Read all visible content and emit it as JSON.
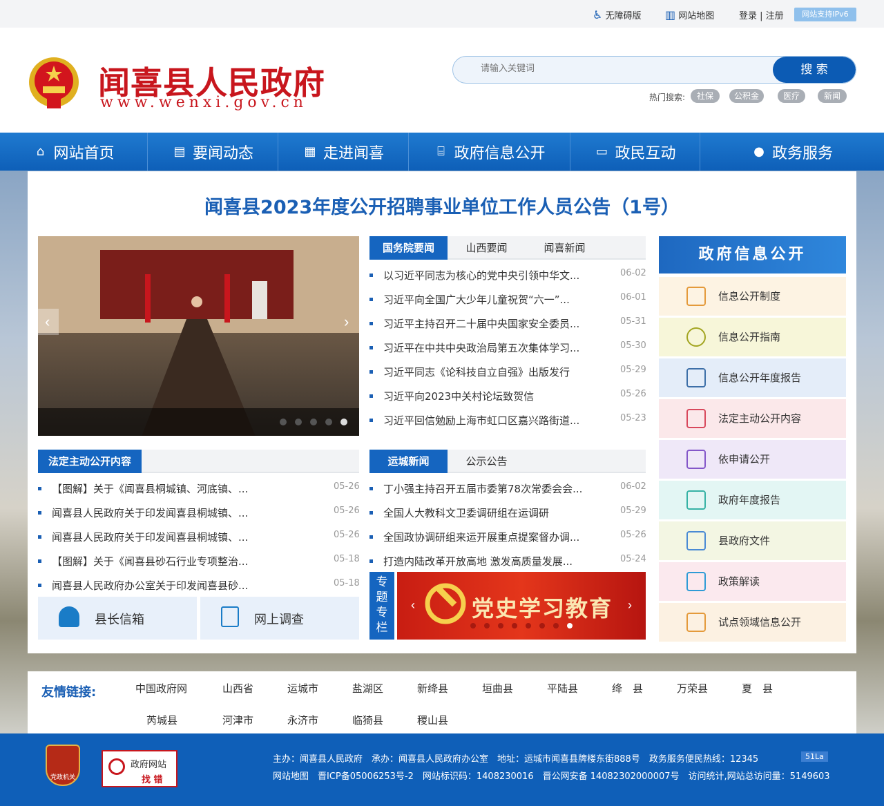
{
  "topbar": {
    "accessibility": "无障碍版",
    "sitemap": "网站地图",
    "login": "登录 | 注册",
    "ipv6": "网站支持IPv6"
  },
  "header": {
    "title": "闻喜县人民政府",
    "url": "www.wenxi.gov.cn",
    "search_placeholder": "请输入关键词",
    "search_button": "搜 索",
    "hot_label": "热门搜索:",
    "hot_tags": [
      "社保",
      "公积金",
      "医疗",
      "新闻"
    ]
  },
  "nav": [
    {
      "label": "网站首页",
      "icon": "home-icon"
    },
    {
      "label": "要闻动态",
      "icon": "news-icon"
    },
    {
      "label": "走进闻喜",
      "icon": "building-icon"
    },
    {
      "label": "政府信息公开",
      "icon": "government-icon"
    },
    {
      "label": "政民互动",
      "icon": "chat-icon"
    },
    {
      "label": "政务服务",
      "icon": "user-icon"
    }
  ],
  "headline": "闻喜县2023年度公开招聘事业单位工作人员公告（1号）",
  "news_tabs": [
    "国务院要闻",
    "山西要闻",
    "闻喜新闻"
  ],
  "news": [
    {
      "title": "以习近平同志为核心的党中央引领中华文...",
      "date": "06-02"
    },
    {
      "title": "习近平向全国广大少年儿童祝贺“六一”...",
      "date": "06-01"
    },
    {
      "title": "习近平主持召开二十届中央国家安全委员...",
      "date": "05-31"
    },
    {
      "title": "习近平在中共中央政治局第五次集体学习...",
      "date": "05-30"
    },
    {
      "title": "习近平同志《论科技自立自强》出版发行",
      "date": "05-29"
    },
    {
      "title": "习近平向2023中关村论坛致贺信",
      "date": "05-26"
    },
    {
      "title": "习近平回信勉励上海市虹口区嘉兴路街道...",
      "date": "05-23"
    }
  ],
  "legal_tab": "法定主动公开内容",
  "legal": [
    {
      "title": "【图解】关于《闻喜县桐城镇、河底镇、...",
      "date": "05-26"
    },
    {
      "title": "闻喜县人民政府关于印发闻喜县桐城镇、...",
      "date": "05-26"
    },
    {
      "title": "闻喜县人民政府关于印发闻喜县桐城镇、...",
      "date": "05-26"
    },
    {
      "title": "【图解】关于《闻喜县砂石行业专项整治...",
      "date": "05-18"
    },
    {
      "title": "闻喜县人民政府办公室关于印发闻喜县砂...",
      "date": "05-18"
    }
  ],
  "yc_tabs": [
    "运城新闻",
    "公示公告"
  ],
  "yc": [
    {
      "title": "丁小强主持召开五届市委第78次常委会会...",
      "date": "06-02"
    },
    {
      "title": "全国人大教科文卫委调研组在运调研",
      "date": "05-29"
    },
    {
      "title": "全国政协调研组来运开展重点提案督办调...",
      "date": "05-26"
    },
    {
      "title": "打造内陆改革开放高地 激发高质量发展...",
      "date": "05-24"
    }
  ],
  "mailbox": "县长信箱",
  "survey": "网上调查",
  "special_label": "专题专栏",
  "special_banner": "党史学习教育",
  "side": {
    "title": "政府信息公开",
    "items": [
      {
        "label": "信息公开制度",
        "bg": "#fdf3e3",
        "color": "#e49a3b"
      },
      {
        "label": "信息公开指南",
        "bg": "#f7f6d9",
        "color": "#a3a522"
      },
      {
        "label": "信息公开年度报告",
        "bg": "#e4edf9",
        "color": "#3d6fa8"
      },
      {
        "label": "法定主动公开内容",
        "bg": "#fbe8ea",
        "color": "#d8485c"
      },
      {
        "label": "依申请公开",
        "bg": "#efe8f8",
        "color": "#8457c9"
      },
      {
        "label": "政府年度报告",
        "bg": "#e3f6f4",
        "color": "#37b2a5"
      },
      {
        "label": "县政府文件",
        "bg": "#f3f6e3",
        "color": "#4a8ad4"
      },
      {
        "label": "政策解读",
        "bg": "#fbe9ee",
        "color": "#2e9bd6"
      },
      {
        "label": "试点领域信息公开",
        "bg": "#fcf1e2",
        "color": "#e49a3b"
      }
    ]
  },
  "links": {
    "title": "友情链接:",
    "row1": [
      "中国政府网",
      "山西省",
      "运城市",
      "盐湖区",
      "新绛县",
      "垣曲县",
      "平陆县",
      "绛　县",
      "万荣县",
      "夏　县"
    ],
    "row2": [
      "芮城县",
      "河津市",
      "永济市",
      "临猗县",
      "稷山县"
    ]
  },
  "footer": {
    "line1": "主办：闻喜县人民政府　承办：闻喜县人民政府办公室　地址：运城市闻喜县牌楼东街888号　政务服务便民热线：12345",
    "badge51": "51La",
    "line2": "网站地图　晋ICP备05006253号-2　网站标识码：1408230016　晋公网安备 14082302000007号　访问统计,网站总访问量：5149603",
    "badge_text": "党政机关",
    "find_error_1": "政府网站",
    "find_error_2": "找 错"
  }
}
